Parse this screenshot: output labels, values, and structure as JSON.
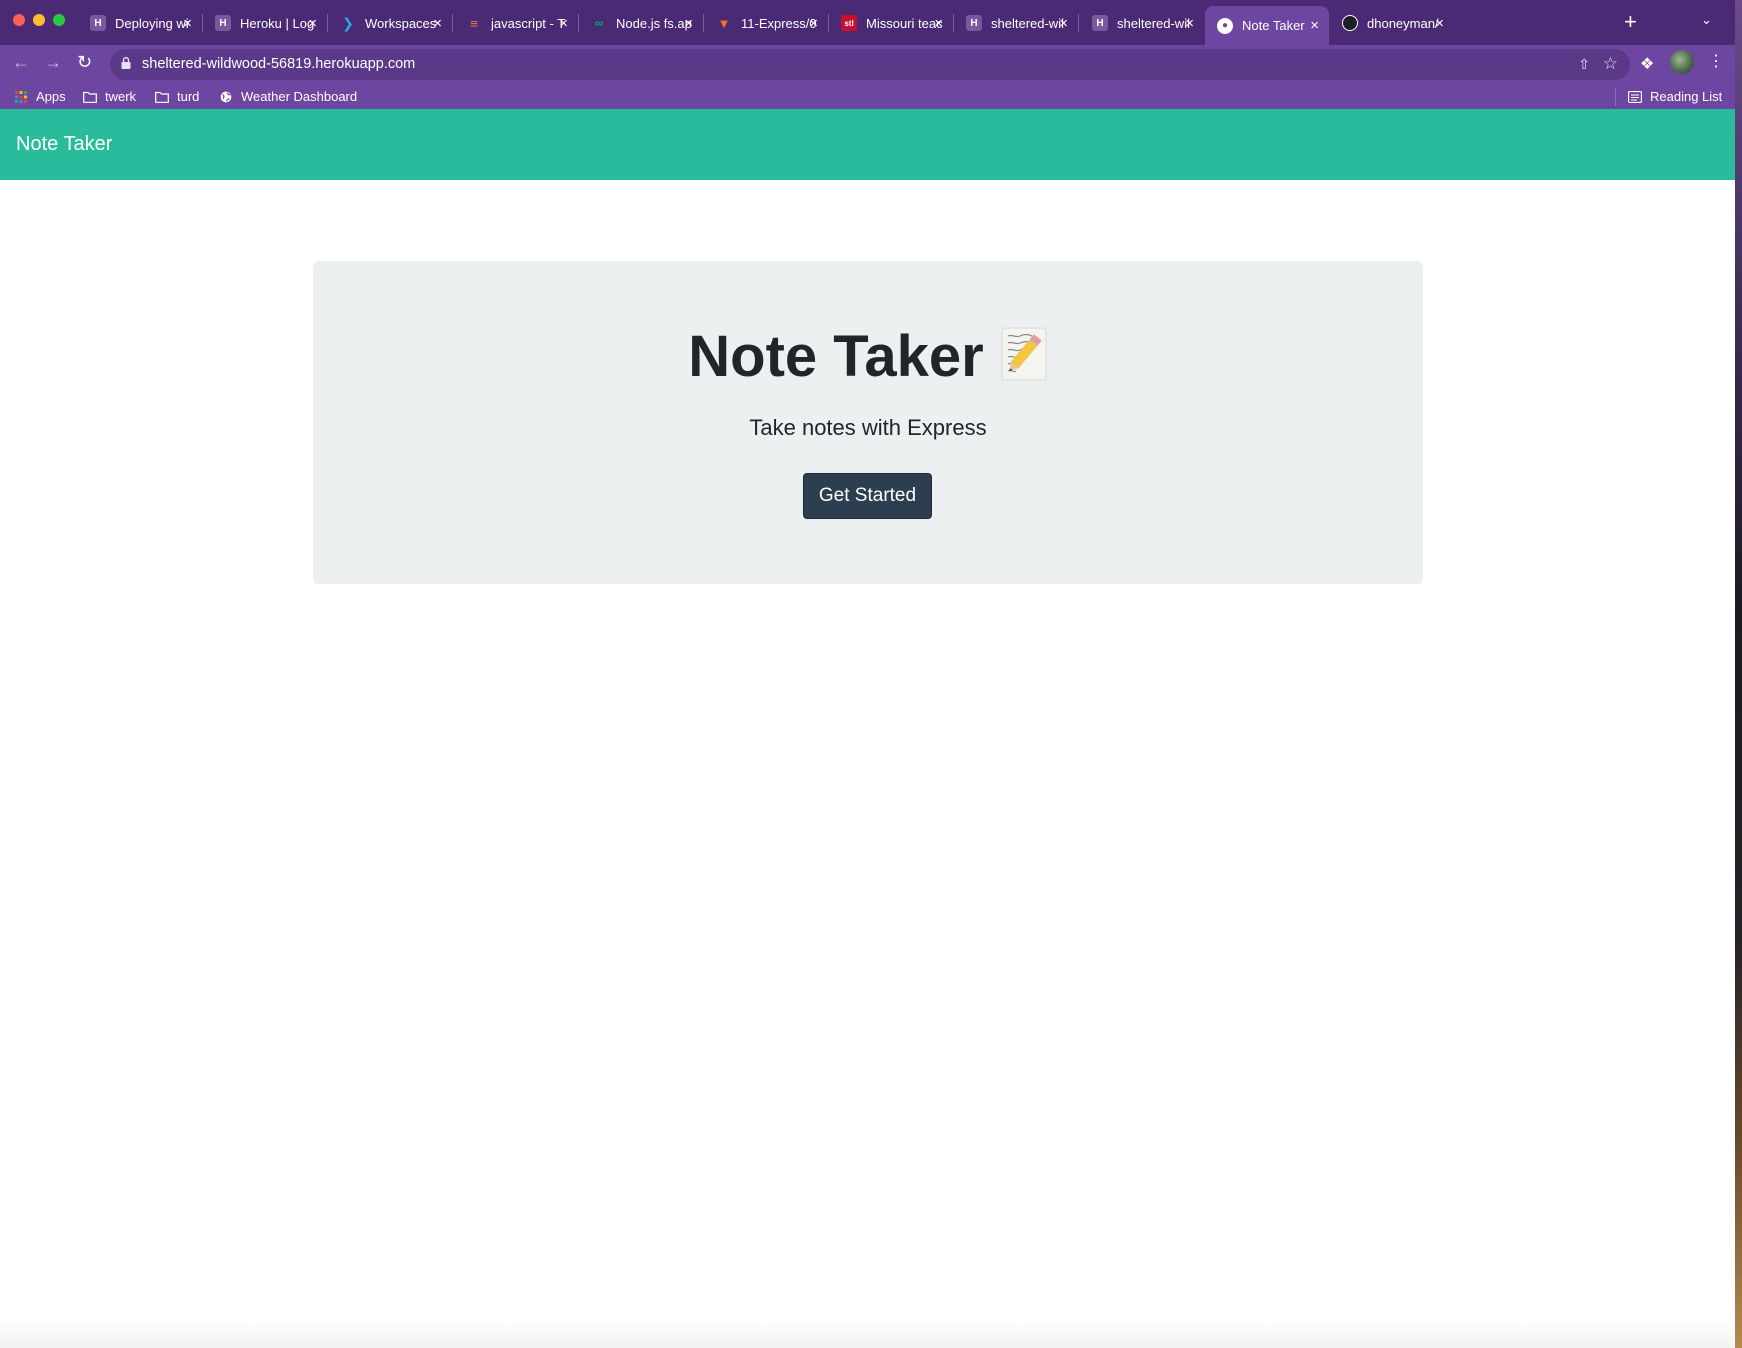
{
  "browser": {
    "tabs": [
      {
        "title": "Deploying wi",
        "favicon": "heroku-icon",
        "color": "#79589f",
        "active": false
      },
      {
        "title": "Heroku | Log",
        "favicon": "heroku-icon",
        "color": "#79589f",
        "active": false
      },
      {
        "title": "Workspaces",
        "favicon": "vscode-icon",
        "color": "#23a9f2",
        "active": false
      },
      {
        "title": "javascript - T",
        "favicon": "stackoverflow-icon",
        "color": "#f48024",
        "active": false
      },
      {
        "title": "Node.js fs.ap",
        "favicon": "w3schools-icon",
        "color": "#04aa6d",
        "active": false
      },
      {
        "title": "11-Express/0",
        "favicon": "gitlab-icon",
        "color": "#fc6d26",
        "active": false
      },
      {
        "title": "Missouri teac",
        "favicon": "stl-news-icon",
        "color": "#c8102e",
        "active": false
      },
      {
        "title": "sheltered-wil",
        "favicon": "heroku-icon",
        "color": "#79589f",
        "active": false
      },
      {
        "title": "sheltered-wil",
        "favicon": "heroku-icon",
        "color": "#79589f",
        "active": false
      },
      {
        "title": "Note Taker",
        "favicon": "globe-icon",
        "color": "#ffffff",
        "active": true
      },
      {
        "title": "dhoneyman/",
        "favicon": "github-icon",
        "color": "#ffffff",
        "active": false
      }
    ],
    "url": "sheltered-wildwood-56819.herokuapp.com",
    "bookmarks": {
      "apps": "Apps",
      "twerk": "twerk",
      "turd": "turd",
      "weather": "Weather Dashboard",
      "reading_list": "Reading List"
    },
    "colors": {
      "tab_strip": "#4a2a74",
      "toolbar": "#6c46a0"
    }
  },
  "app": {
    "brand": "Note Taker",
    "hero": {
      "title": "Note Taker",
      "emoji_icon": "memo-pencil-icon",
      "subtitle": "Take notes with Express",
      "button": "Get Started"
    },
    "colors": {
      "navbar": "#29bc9c",
      "jumbotron": "#ecf0f1",
      "button": "#2c3e50"
    }
  }
}
